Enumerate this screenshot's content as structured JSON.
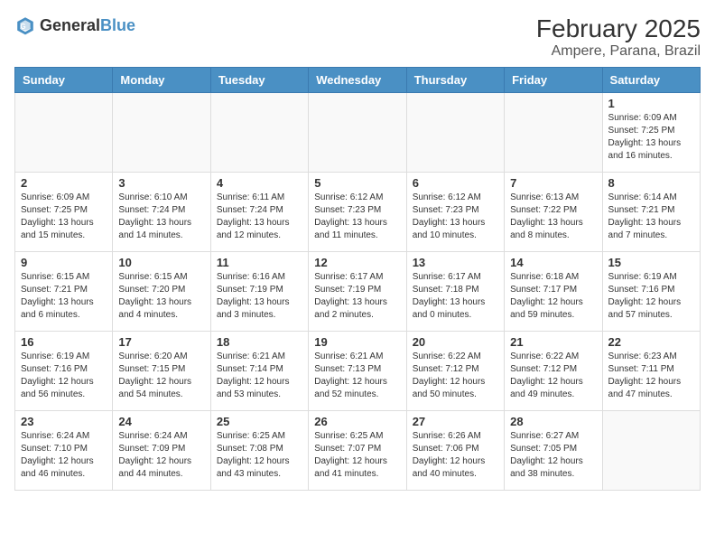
{
  "header": {
    "logo_general": "General",
    "logo_blue": "Blue",
    "month": "February 2025",
    "location": "Ampere, Parana, Brazil"
  },
  "days_of_week": [
    "Sunday",
    "Monday",
    "Tuesday",
    "Wednesday",
    "Thursday",
    "Friday",
    "Saturday"
  ],
  "weeks": [
    [
      {
        "day": "",
        "info": ""
      },
      {
        "day": "",
        "info": ""
      },
      {
        "day": "",
        "info": ""
      },
      {
        "day": "",
        "info": ""
      },
      {
        "day": "",
        "info": ""
      },
      {
        "day": "",
        "info": ""
      },
      {
        "day": "1",
        "info": "Sunrise: 6:09 AM\nSunset: 7:25 PM\nDaylight: 13 hours and 16 minutes."
      }
    ],
    [
      {
        "day": "2",
        "info": "Sunrise: 6:09 AM\nSunset: 7:25 PM\nDaylight: 13 hours and 15 minutes."
      },
      {
        "day": "3",
        "info": "Sunrise: 6:10 AM\nSunset: 7:24 PM\nDaylight: 13 hours and 14 minutes."
      },
      {
        "day": "4",
        "info": "Sunrise: 6:11 AM\nSunset: 7:24 PM\nDaylight: 13 hours and 12 minutes."
      },
      {
        "day": "5",
        "info": "Sunrise: 6:12 AM\nSunset: 7:23 PM\nDaylight: 13 hours and 11 minutes."
      },
      {
        "day": "6",
        "info": "Sunrise: 6:12 AM\nSunset: 7:23 PM\nDaylight: 13 hours and 10 minutes."
      },
      {
        "day": "7",
        "info": "Sunrise: 6:13 AM\nSunset: 7:22 PM\nDaylight: 13 hours and 8 minutes."
      },
      {
        "day": "8",
        "info": "Sunrise: 6:14 AM\nSunset: 7:21 PM\nDaylight: 13 hours and 7 minutes."
      }
    ],
    [
      {
        "day": "9",
        "info": "Sunrise: 6:15 AM\nSunset: 7:21 PM\nDaylight: 13 hours and 6 minutes."
      },
      {
        "day": "10",
        "info": "Sunrise: 6:15 AM\nSunset: 7:20 PM\nDaylight: 13 hours and 4 minutes."
      },
      {
        "day": "11",
        "info": "Sunrise: 6:16 AM\nSunset: 7:19 PM\nDaylight: 13 hours and 3 minutes."
      },
      {
        "day": "12",
        "info": "Sunrise: 6:17 AM\nSunset: 7:19 PM\nDaylight: 13 hours and 2 minutes."
      },
      {
        "day": "13",
        "info": "Sunrise: 6:17 AM\nSunset: 7:18 PM\nDaylight: 13 hours and 0 minutes."
      },
      {
        "day": "14",
        "info": "Sunrise: 6:18 AM\nSunset: 7:17 PM\nDaylight: 12 hours and 59 minutes."
      },
      {
        "day": "15",
        "info": "Sunrise: 6:19 AM\nSunset: 7:16 PM\nDaylight: 12 hours and 57 minutes."
      }
    ],
    [
      {
        "day": "16",
        "info": "Sunrise: 6:19 AM\nSunset: 7:16 PM\nDaylight: 12 hours and 56 minutes."
      },
      {
        "day": "17",
        "info": "Sunrise: 6:20 AM\nSunset: 7:15 PM\nDaylight: 12 hours and 54 minutes."
      },
      {
        "day": "18",
        "info": "Sunrise: 6:21 AM\nSunset: 7:14 PM\nDaylight: 12 hours and 53 minutes."
      },
      {
        "day": "19",
        "info": "Sunrise: 6:21 AM\nSunset: 7:13 PM\nDaylight: 12 hours and 52 minutes."
      },
      {
        "day": "20",
        "info": "Sunrise: 6:22 AM\nSunset: 7:12 PM\nDaylight: 12 hours and 50 minutes."
      },
      {
        "day": "21",
        "info": "Sunrise: 6:22 AM\nSunset: 7:12 PM\nDaylight: 12 hours and 49 minutes."
      },
      {
        "day": "22",
        "info": "Sunrise: 6:23 AM\nSunset: 7:11 PM\nDaylight: 12 hours and 47 minutes."
      }
    ],
    [
      {
        "day": "23",
        "info": "Sunrise: 6:24 AM\nSunset: 7:10 PM\nDaylight: 12 hours and 46 minutes."
      },
      {
        "day": "24",
        "info": "Sunrise: 6:24 AM\nSunset: 7:09 PM\nDaylight: 12 hours and 44 minutes."
      },
      {
        "day": "25",
        "info": "Sunrise: 6:25 AM\nSunset: 7:08 PM\nDaylight: 12 hours and 43 minutes."
      },
      {
        "day": "26",
        "info": "Sunrise: 6:25 AM\nSunset: 7:07 PM\nDaylight: 12 hours and 41 minutes."
      },
      {
        "day": "27",
        "info": "Sunrise: 6:26 AM\nSunset: 7:06 PM\nDaylight: 12 hours and 40 minutes."
      },
      {
        "day": "28",
        "info": "Sunrise: 6:27 AM\nSunset: 7:05 PM\nDaylight: 12 hours and 38 minutes."
      },
      {
        "day": "",
        "info": ""
      }
    ]
  ]
}
